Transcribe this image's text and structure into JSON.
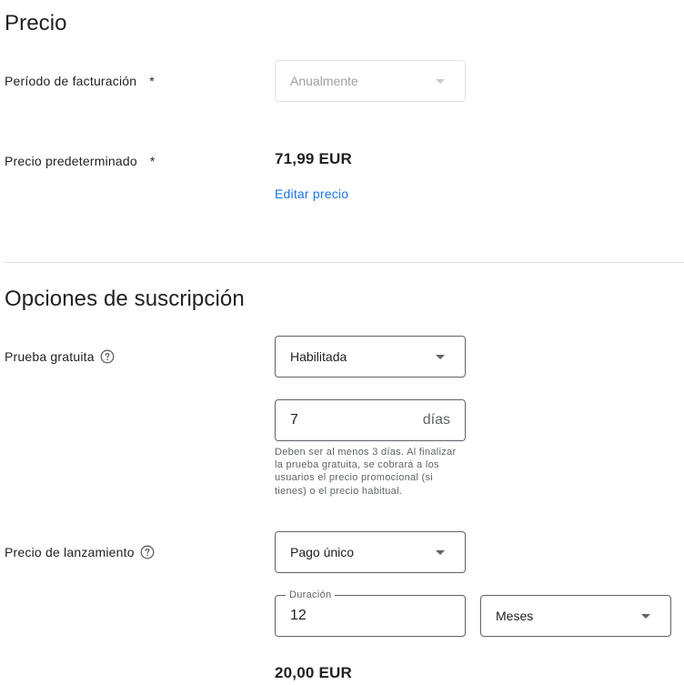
{
  "price_section": {
    "title": "Precio",
    "billing_period": {
      "label": "Período de facturación",
      "required_mark": "*",
      "value": "Anualmente"
    },
    "default_price": {
      "label": "Precio predeterminado",
      "required_mark": "*",
      "value": "71,99 EUR",
      "edit_link": "Editar precio"
    }
  },
  "subscription_section": {
    "title": "Opciones de suscripción",
    "free_trial": {
      "label": "Prueba gratuita",
      "help_icon": "help-circle-icon",
      "select_value": "Habilitada",
      "days_value": "7",
      "days_suffix": "días",
      "helper_text": "Deben ser al menos 3 días. Al finalizar la prueba gratuita, se cobrará a los usuarios el precio promocional (si tienes) o el precio habitual."
    },
    "intro_price": {
      "label": "Precio de lanzamiento",
      "help_icon": "help-circle-icon",
      "select_value": "Pago único",
      "duration_label": "Duración",
      "duration_value": "12",
      "unit_value": "Meses",
      "price_value": "20,00 EUR"
    }
  },
  "colors": {
    "link": "#1a73e8",
    "text": "#202124",
    "secondary_text": "#5f6368",
    "divider": "#dadce0"
  }
}
